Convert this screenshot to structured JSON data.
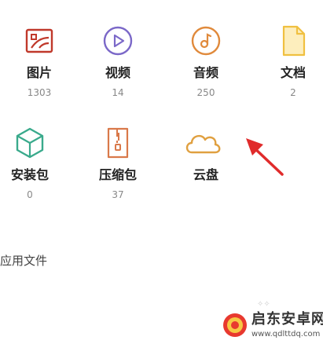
{
  "categories_row1": [
    {
      "label": "图片",
      "count": "1303",
      "icon": "image-icon",
      "color": "#c0392b"
    },
    {
      "label": "视频",
      "count": "14",
      "icon": "video-icon",
      "color": "#7b68c8"
    },
    {
      "label": "音频",
      "count": "250",
      "icon": "audio-icon",
      "color": "#e08a3c"
    },
    {
      "label": "文档",
      "count": "2",
      "icon": "document-icon",
      "color": "#f0c040"
    }
  ],
  "categories_row2": [
    {
      "label": "安装包",
      "count": "0",
      "icon": "package-icon",
      "color": "#3aaa8c"
    },
    {
      "label": "压缩包",
      "count": "37",
      "icon": "zip-icon",
      "color": "#d9794a"
    },
    {
      "label": "云盘",
      "icon": "cloud-icon",
      "color": "#e0a040"
    }
  ],
  "section": {
    "title": "应用文件"
  },
  "annotation": {
    "icon": "red-arrow-icon",
    "color": "#e02b2b"
  },
  "watermark": {
    "name": "启东安卓网",
    "url": "www.qdlttdq.com",
    "icon": "watermark-logo-icon"
  }
}
